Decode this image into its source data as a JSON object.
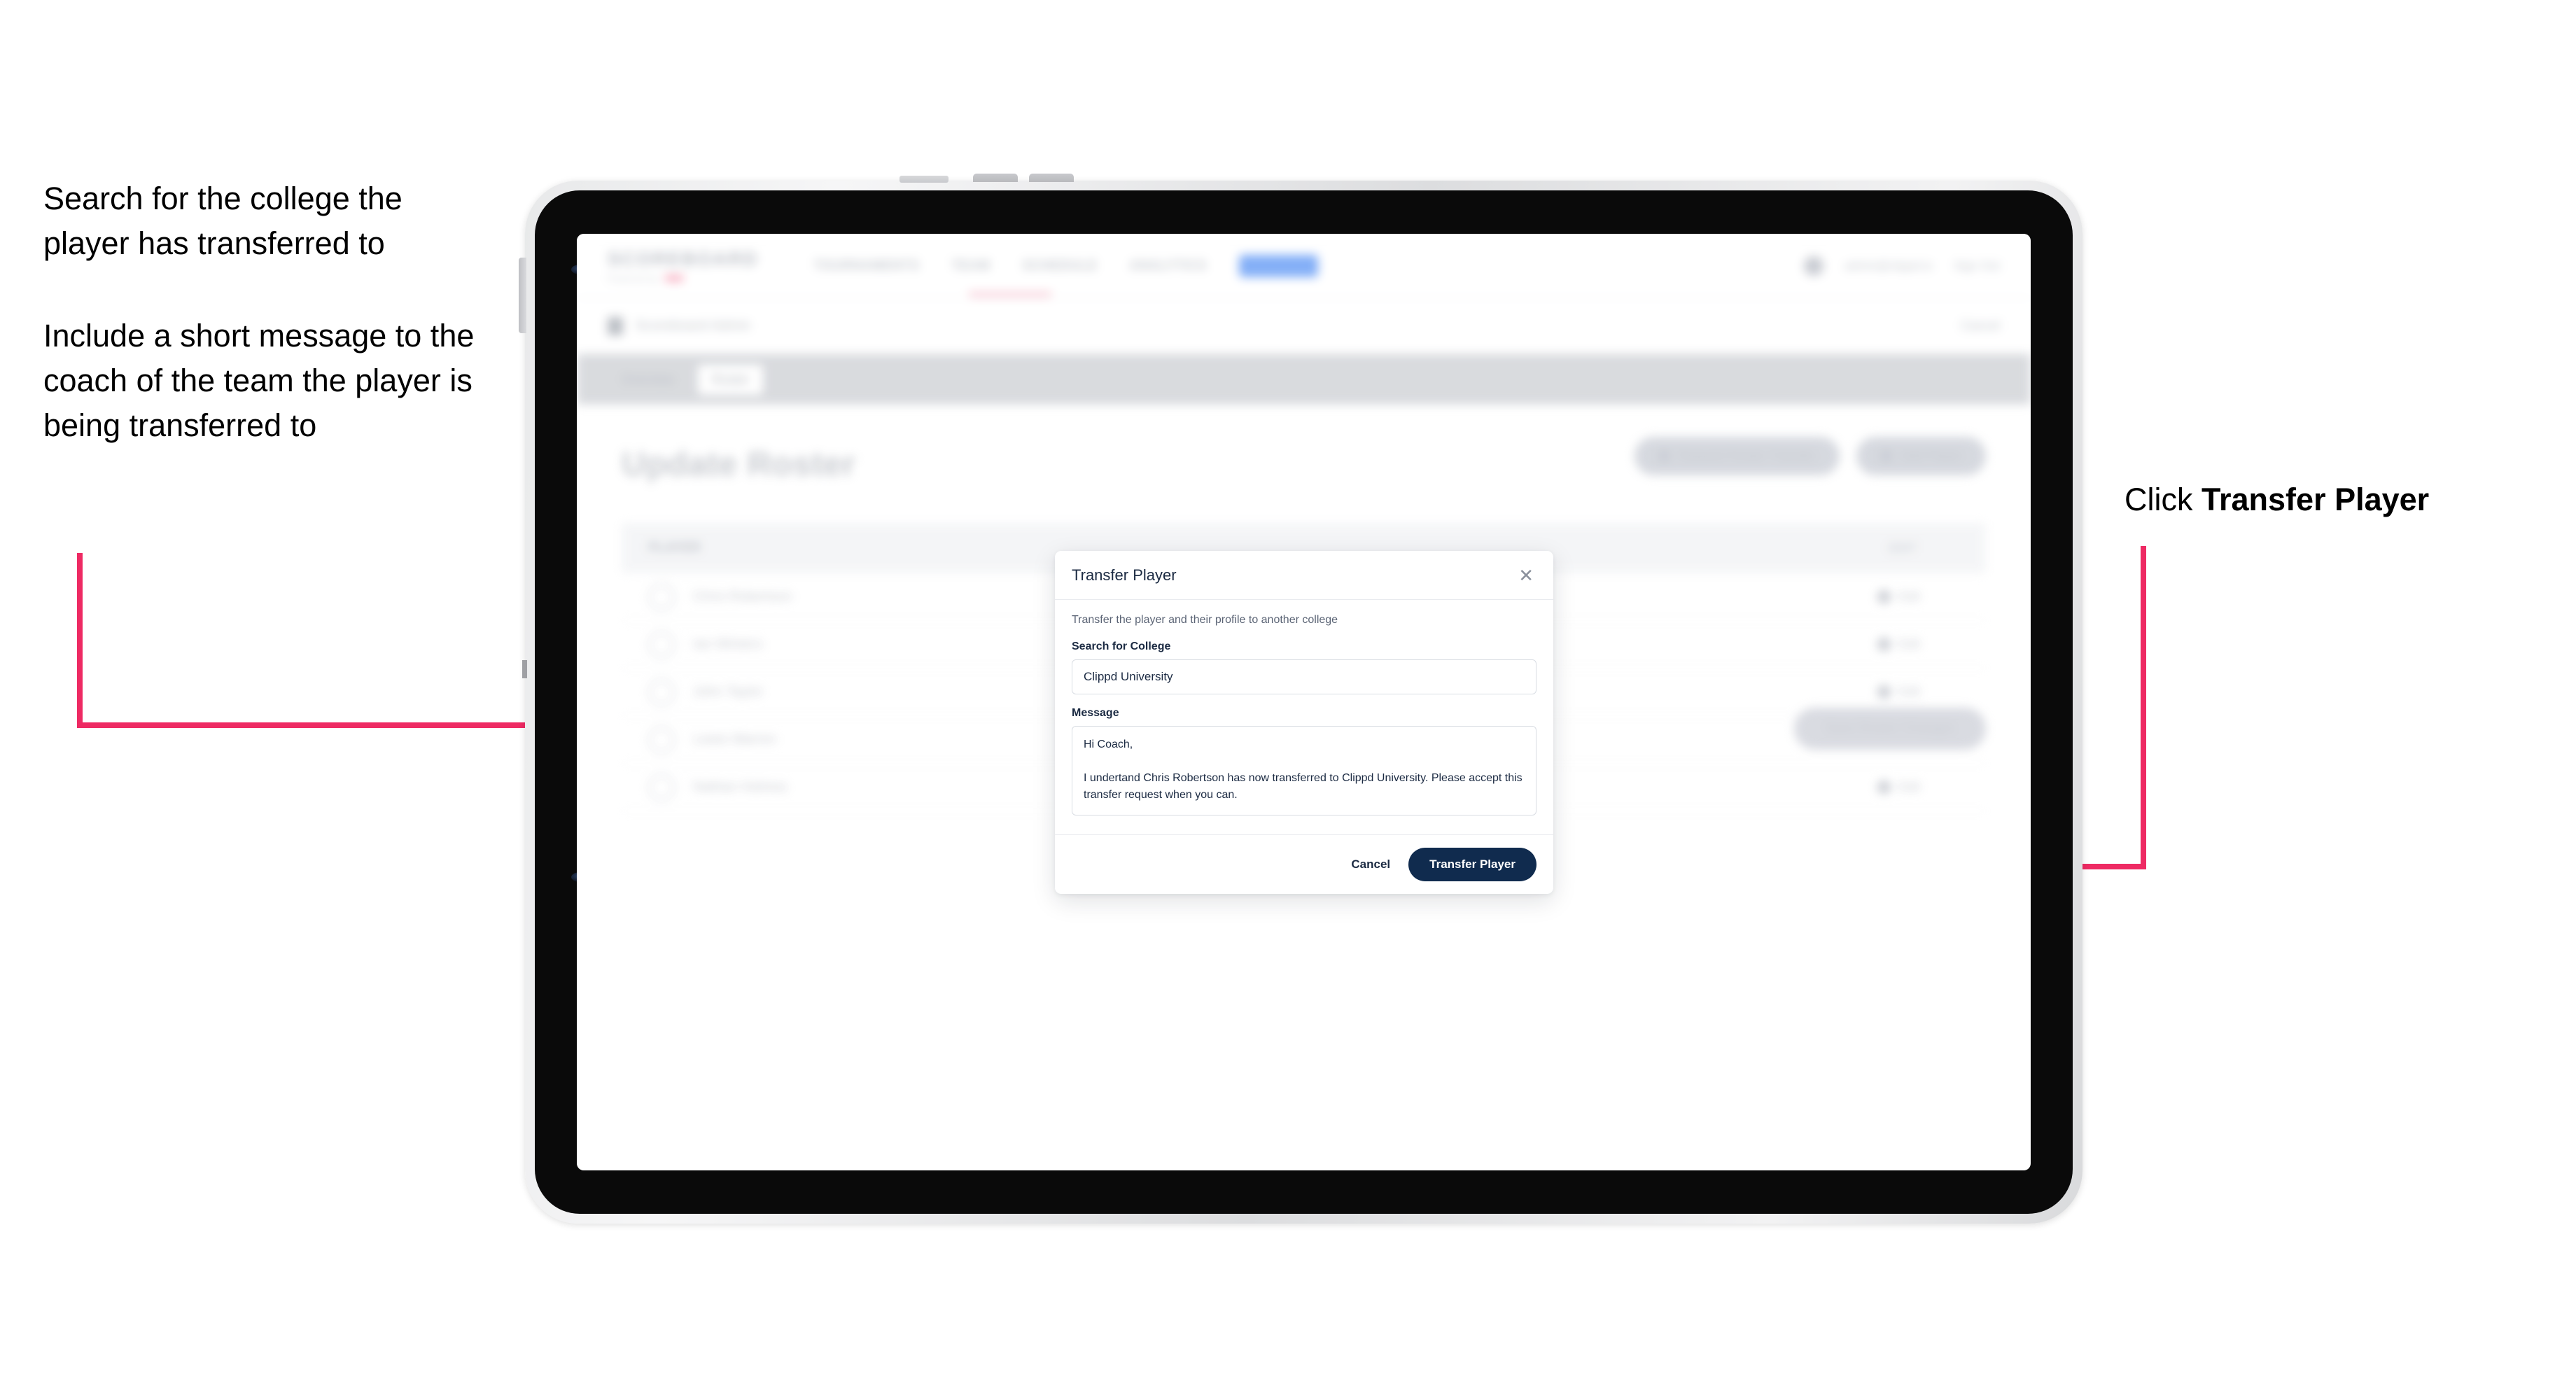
{
  "annotations": {
    "left": [
      "Search for the college the player has transferred to",
      "Include a short message to the coach of the team the player is being transferred to"
    ],
    "right_prefix": "Click ",
    "right_bold": "Transfer Player"
  },
  "app": {
    "brand": {
      "word": "SCOREBOARD",
      "sub": "Powered by"
    },
    "nav": [
      "TOURNAMENTS",
      "TEAM",
      "SCHEDULE",
      "ANALYTICS",
      "ROSTER"
    ],
    "header_right": {
      "user": "admin@clippd.io",
      "menu": "Sign Out"
    },
    "subbar": {
      "label": "Scoreboard Admin",
      "right": "Cancel"
    },
    "tabs": [
      {
        "label": "Overview",
        "active": false
      },
      {
        "label": "Roster",
        "active": true
      }
    ],
    "page_title": "Update Roster",
    "page_actions": [
      {
        "label": "Request Roster Transfer"
      },
      {
        "label": "Add Player"
      }
    ],
    "table": {
      "columns": [
        "PLAYER",
        "EDIT"
      ],
      "rows": [
        {
          "name": "Chris Robertson",
          "action": "Edit"
        },
        {
          "name": "Ian Winters",
          "action": "Edit"
        },
        {
          "name": "John Taylor",
          "action": "Edit"
        },
        {
          "name": "Lewis Warren",
          "action": "Edit"
        },
        {
          "name": "Nathan Holmes",
          "action": "Edit"
        }
      ]
    },
    "bottom_action": "Save Roster Changes"
  },
  "modal": {
    "title": "Transfer Player",
    "close_icon": "close-icon",
    "description": "Transfer the player and their profile to another college",
    "college_label": "Search for College",
    "college_value": "Clippd University",
    "college_placeholder": "Search for College",
    "message_label": "Message",
    "message_value": "Hi Coach,\n\nI undertand Chris Robertson has now transferred to Clippd University. Please accept this transfer request when you can.",
    "message_placeholder": "Message",
    "cancel_label": "Cancel",
    "submit_label": "Transfer Player"
  },
  "colors": {
    "accent_pink": "#ee2a63",
    "primary_navy": "#102b4e",
    "text_dark": "#1b2a42"
  }
}
